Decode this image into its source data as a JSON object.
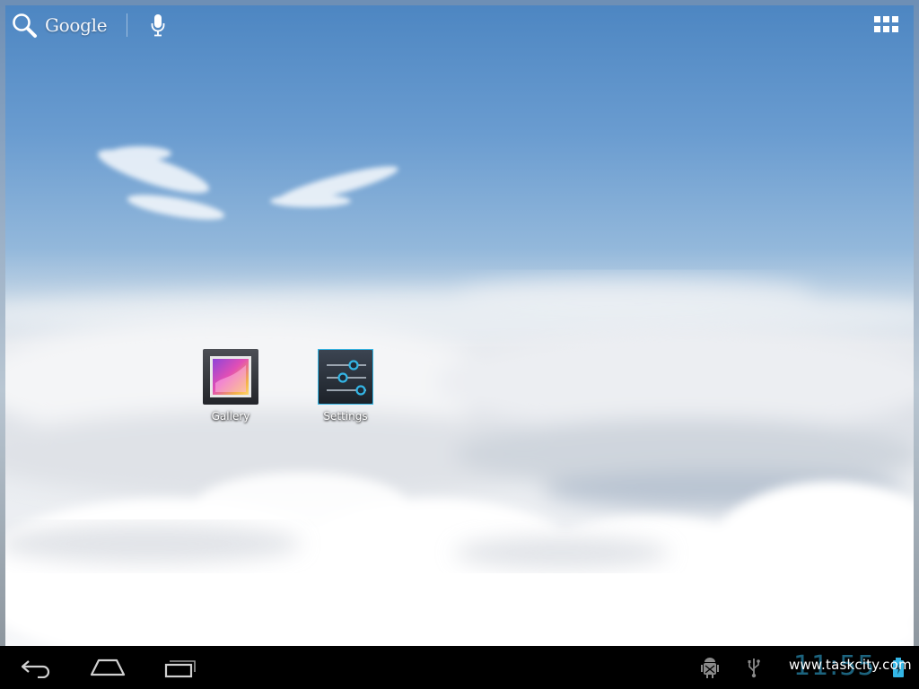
{
  "search_bar": {
    "brand": "Google",
    "icon": "search-icon",
    "mic_icon": "microphone-icon"
  },
  "apps_button": {
    "icon": "all-apps-grid-icon"
  },
  "apps": [
    {
      "label": "Gallery",
      "icon": "gallery-icon"
    },
    {
      "label": "Settings",
      "icon": "settings-sliders-icon"
    }
  ],
  "navbar": {
    "back_icon": "back-icon",
    "home_icon": "home-icon",
    "recents_icon": "recent-apps-icon",
    "status": {
      "debug_icon": "android-debug-icon",
      "usb_icon": "usb-icon",
      "watermark": "www.taskcity.com",
      "clock": "11:55",
      "battery_icon": "battery-icon"
    }
  },
  "colors": {
    "accent": "#33b5e5",
    "navbar": "#000000",
    "sky_top": "#4d86c2"
  }
}
